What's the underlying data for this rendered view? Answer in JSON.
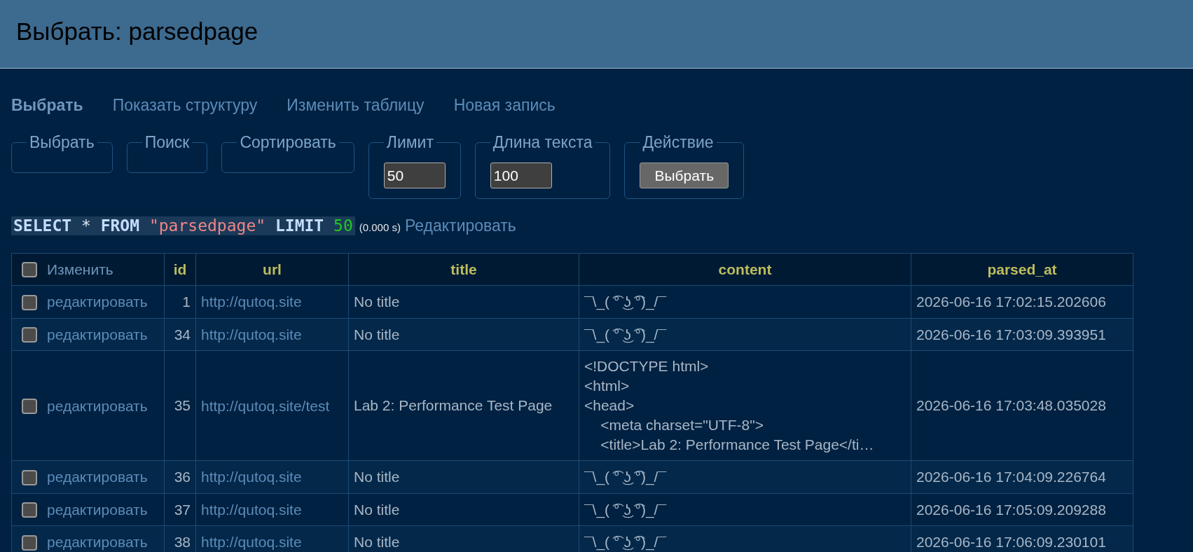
{
  "header": {
    "title": "Выбрать: parsedpage"
  },
  "nav": [
    {
      "label": "Выбрать",
      "selected": true
    },
    {
      "label": "Показать структуру",
      "selected": false
    },
    {
      "label": "Изменить таблицу",
      "selected": false
    },
    {
      "label": "Новая запись",
      "selected": false
    }
  ],
  "form": {
    "fieldsets": [
      {
        "kind": "empty",
        "legend": "Выбрать"
      },
      {
        "kind": "empty",
        "legend": "Поиск"
      },
      {
        "kind": "empty",
        "legend": "Сортировать"
      },
      {
        "kind": "input",
        "legend": "Лимит",
        "value": "50"
      },
      {
        "kind": "input",
        "legend": "Длина текста",
        "value": "100"
      },
      {
        "kind": "button",
        "legend": "Действие",
        "button": "Выбрать"
      }
    ]
  },
  "query": {
    "tokens": [
      {
        "kind": "keyword",
        "text": "SELECT"
      },
      {
        "kind": "operator",
        "text": "*"
      },
      {
        "kind": "keyword",
        "text": "FROM"
      },
      {
        "kind": "string",
        "text": "\"parsedpage\""
      },
      {
        "kind": "keyword",
        "text": "LIMIT"
      },
      {
        "kind": "number",
        "text": "50"
      }
    ],
    "time": "(0.000 s)",
    "edit_link": "Редактировать"
  },
  "table": {
    "select_all": {
      "label": "Изменить",
      "checked": false
    },
    "columns": [
      "id",
      "url",
      "title",
      "content",
      "parsed_at"
    ],
    "rows": [
      {
        "checked": false,
        "edit": "редактировать",
        "id": "1",
        "url": "http://qutoq.site",
        "title": "No title",
        "content": "¯\\_( ͡° ͜ʖ ͡°)_/¯",
        "parsed_at": "2026-06-16 17:02:15.202606"
      },
      {
        "checked": false,
        "edit": "редактировать",
        "id": "34",
        "url": "http://qutoq.site",
        "title": "No title",
        "content": "¯\\_( ͡° ͜ʖ ͡°)_/¯",
        "parsed_at": "2026-06-16 17:03:09.393951"
      },
      {
        "checked": false,
        "edit": "редактировать",
        "id": "35",
        "url": "http://qutoq.site/test",
        "title": "Lab 2: Performance Test Page",
        "content": "<!DOCTYPE html>\n<html>\n<head>\n    <meta charset=\"UTF-8\">\n    <title>Lab 2: Performance Test Page</ti…",
        "parsed_at": "2026-06-16 17:03:48.035028"
      },
      {
        "checked": false,
        "edit": "редактировать",
        "id": "36",
        "url": "http://qutoq.site",
        "title": "No title",
        "content": "¯\\_( ͡° ͜ʖ ͡°)_/¯",
        "parsed_at": "2026-06-16 17:04:09.226764"
      },
      {
        "checked": false,
        "edit": "редактировать",
        "id": "37",
        "url": "http://qutoq.site",
        "title": "No title",
        "content": "¯\\_( ͡° ͜ʖ ͡°)_/¯",
        "parsed_at": "2026-06-16 17:05:09.209288"
      },
      {
        "checked": false,
        "edit": "редактировать",
        "id": "38",
        "url": "http://qutoq.site",
        "title": "No title",
        "content": "¯\\_( ͡° ͜ʖ ͡°)_/¯",
        "parsed_at": "2026-06-16 17:06:09.230101"
      }
    ]
  }
}
